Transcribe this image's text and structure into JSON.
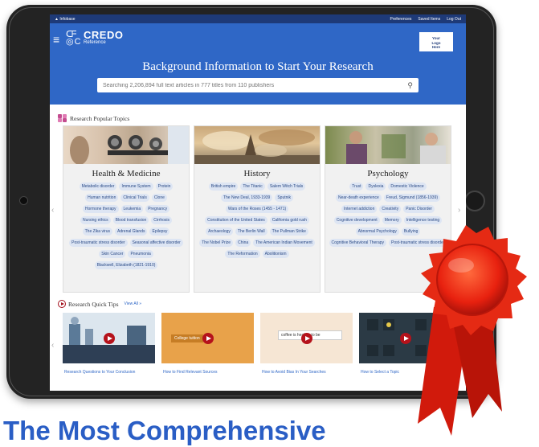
{
  "topbar": {
    "brand": "▲ Infobase",
    "links": [
      "Preferences",
      "Saved Items",
      "Log Out"
    ]
  },
  "header": {
    "logo_name": "CREDO",
    "logo_sub": "Reference",
    "login_label": "Your\nLogo\nHere"
  },
  "hero": {
    "title": "Background Information to Start Your Research",
    "search_placeholder": "Searching 2,206,894 full text articles in 777 titles from 110 publishers"
  },
  "popular": {
    "title": "Research Popular Topics",
    "cards": [
      {
        "title": "Health & Medicine",
        "tags": [
          "Metabolic disorder",
          "Immune System",
          "Protein",
          "Human nutrition",
          "Clinical Trials",
          "Clone",
          "Hormone therapy",
          "Leukemia",
          "Pregnancy",
          "Nursing ethics",
          "Blood transfusion",
          "Cirrhosis",
          "The Zika virus",
          "Adrenal Glands",
          "Epilepsy",
          "Post-traumatic stress disorder",
          "Seasonal affective disorder",
          "Skin Cancer",
          "Pneumonia",
          "Blackwell, Elizabeth (1821-1910)"
        ]
      },
      {
        "title": "History",
        "tags": [
          "British empire",
          "The Titanic",
          "Salem Witch Trials",
          "The New Deal, 1933-1939",
          "Sputnik",
          "Wars of the Roses (1455 - 1471)",
          "Constitution of the United States",
          "California gold rush",
          "Archaeology",
          "The Berlin Wall",
          "The Pullman Strike",
          "The Nobel Prize",
          "China",
          "The American Indian Movement",
          "The Reformation",
          "Abolitionism"
        ]
      },
      {
        "title": "Psychology",
        "tags": [
          "Trust",
          "Dyslexia",
          "Domestic Violence",
          "Near-death experience",
          "Freud, Sigmund (1856-1939)",
          "Internet addiction",
          "Creativity",
          "Panic Disorder",
          "Cognitive development",
          "Memory",
          "Intelligence testing",
          "Abnormal Psychology",
          "Bullying",
          "Cognitive Behavioral Therapy",
          "Post-traumatic stress disorder"
        ]
      }
    ]
  },
  "tips": {
    "title": "Research Quick Tips",
    "view_all": "View All »",
    "items": [
      {
        "caption": "Research Questions to Your Conclusion"
      },
      {
        "caption": "How to Find Relevant Sources",
        "thumb_text": "College tuition"
      },
      {
        "caption": "How to Avoid Bias In Your Searches",
        "thumb_text": "coffee is healthy to be"
      },
      {
        "caption": "How to Select a Topic"
      }
    ]
  },
  "headline": "The Most Comprehensive",
  "colors": {
    "header_blue": "#2f67c6",
    "topbar_navy": "#1e3a78",
    "tag_bg": "#dde5f3",
    "ribbon_red": "#e8210f",
    "headline_blue": "#2a5ec5"
  }
}
